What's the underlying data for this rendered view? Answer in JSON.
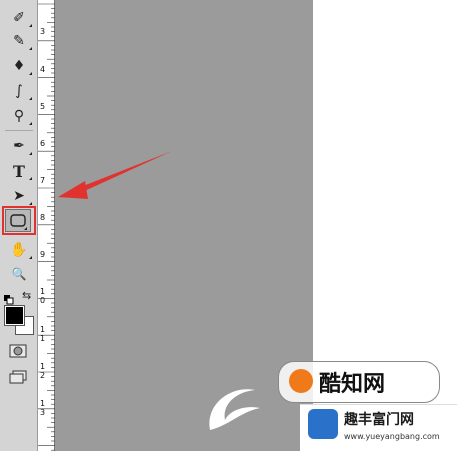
{
  "toolbar": {
    "tools": [
      {
        "name": "history-brush-tool",
        "glyph": "✐"
      },
      {
        "name": "eraser-tool",
        "glyph": "✎"
      },
      {
        "name": "paint-bucket-tool",
        "glyph": "♦"
      },
      {
        "name": "blur-tool",
        "glyph": "∫"
      },
      {
        "name": "dodge-tool",
        "glyph": "⚲"
      },
      {
        "name": "pen-tool",
        "glyph": "✒"
      },
      {
        "name": "type-tool",
        "glyph": "T"
      },
      {
        "name": "path-selection-tool",
        "glyph": "➤"
      },
      {
        "name": "rounded-rectangle-tool",
        "glyph": "▢",
        "selected": true
      },
      {
        "name": "hand-tool",
        "glyph": "✋"
      },
      {
        "name": "zoom-tool",
        "glyph": "🔍"
      }
    ],
    "foreground_color": "#000000",
    "background_color": "#ffffff"
  },
  "ruler": {
    "labels": [
      "3",
      "4",
      "5",
      "6",
      "7",
      "8",
      "9",
      "1",
      "0",
      "1",
      "1",
      "1",
      "2",
      "1",
      "3"
    ]
  },
  "highlight_color": "#e0332f",
  "watermark": {
    "brand_text": "酷知网",
    "site_text": "趣丰富门网",
    "site_url": "www.yueyangbang.com"
  }
}
